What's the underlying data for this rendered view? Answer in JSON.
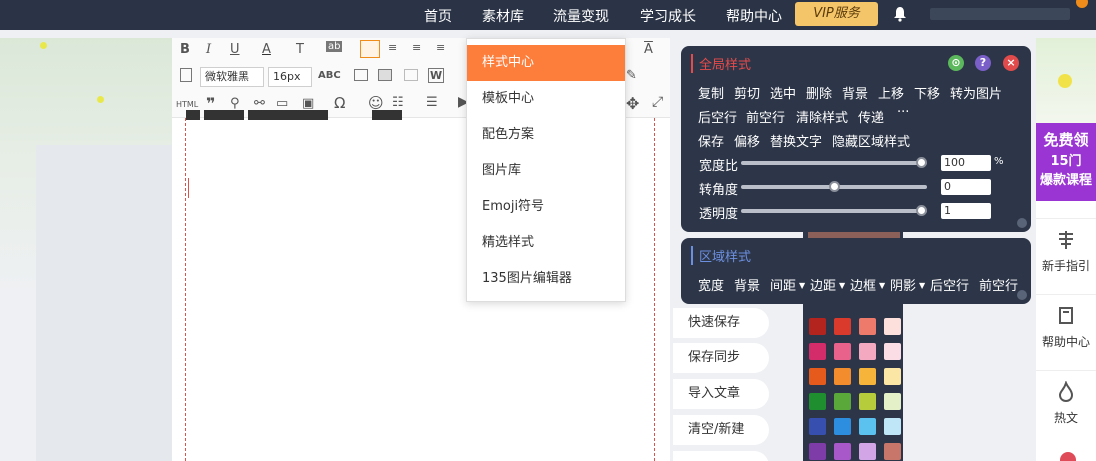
{
  "topnav": {
    "items": [
      "首页",
      "素材库",
      "流量变现",
      "学习成长",
      "帮助中心"
    ],
    "vip_label": "VIP服务"
  },
  "toolbar": {
    "font_family": "微软雅黑",
    "font_size": "16px",
    "abc_label": "ABC",
    "html_label": "HTML"
  },
  "dropdown": {
    "items": [
      "样式中心",
      "模板中心",
      "配色方案",
      "图片库",
      "Emoji符号",
      "精选样式",
      "135图片编辑器"
    ],
    "active_index": 0
  },
  "global_panel": {
    "title": "全局样式",
    "row1": [
      "复制",
      "剪切",
      "选中",
      "删除",
      "背景",
      "上移",
      "下移",
      "转为图片"
    ],
    "row2": [
      "后空行",
      "前空行",
      "清除样式",
      "传递",
      "···"
    ],
    "row3": [
      "保存",
      "偏移",
      "替换文字",
      "隐藏区域样式"
    ],
    "sliders": [
      {
        "label": "宽度比",
        "value": "100",
        "unit": "%",
        "level": 1.0
      },
      {
        "label": "转角度",
        "value": "0",
        "unit": "",
        "level": 0.5
      },
      {
        "label": "透明度",
        "value": "1",
        "unit": "",
        "level": 1.0
      }
    ]
  },
  "region_panel": {
    "title": "区域样式",
    "items": [
      "宽度",
      "背景",
      "间距",
      "边距",
      "边框",
      "阴影",
      "后空行",
      "前空行"
    ]
  },
  "side_buttons": [
    "快速保存",
    "保存同步",
    "导入文章",
    "清空/新建"
  ],
  "palette": {
    "colors": [
      [
        "#b3241f",
        "#d93a2b",
        "#ee7a6c",
        "#fde0dc"
      ],
      [
        "#d42b6a",
        "#e9628c",
        "#f4a9c0",
        "#fbdde6"
      ],
      [
        "#e65a1c",
        "#f28c2c",
        "#f6b43a",
        "#fbe6a6"
      ],
      [
        "#1e8e2e",
        "#5aa83a",
        "#b6cc3a",
        "#e4f0c8"
      ],
      [
        "#3750b0",
        "#2d8ee0",
        "#5bc2f0",
        "#bfe6f7"
      ],
      [
        "#7d3ca8",
        "#a858c8",
        "#d2a6e6",
        "#c9766a"
      ]
    ]
  },
  "right_col": {
    "promo_line1": "免费领",
    "promo_line2": "15门",
    "promo_line3": "爆款课程",
    "items": [
      {
        "label": "新手指引",
        "icon": "guide-icon"
      },
      {
        "label": "帮助中心",
        "icon": "help-center-icon"
      },
      {
        "label": "热文",
        "icon": "flame-icon"
      }
    ]
  }
}
